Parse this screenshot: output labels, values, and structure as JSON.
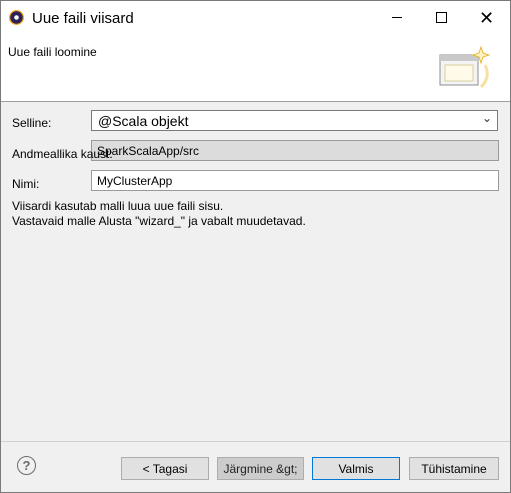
{
  "window": {
    "title": "Uue faili viisard"
  },
  "header": {
    "description": "Uue faili loomine"
  },
  "form": {
    "type_label": "Selline:",
    "type_value": "@Scala objekt",
    "source_label": "Andmeallika kaust:",
    "source_value": "SparkScalaApp/src",
    "name_label": "Nimi:",
    "name_value": "MyClusterApp"
  },
  "info": {
    "line1": "Viisardi kasutab malli luua uue faili sisu.",
    "line2": "Vastavaid malle Alusta \"wizard_\" ja vabalt muudetavad."
  },
  "buttons": {
    "back": "< Tagasi",
    "next": "Järgmine &gt;",
    "finish": "Valmis",
    "cancel": "Tühistamine"
  },
  "colors": {
    "accent": "#0078d7"
  }
}
